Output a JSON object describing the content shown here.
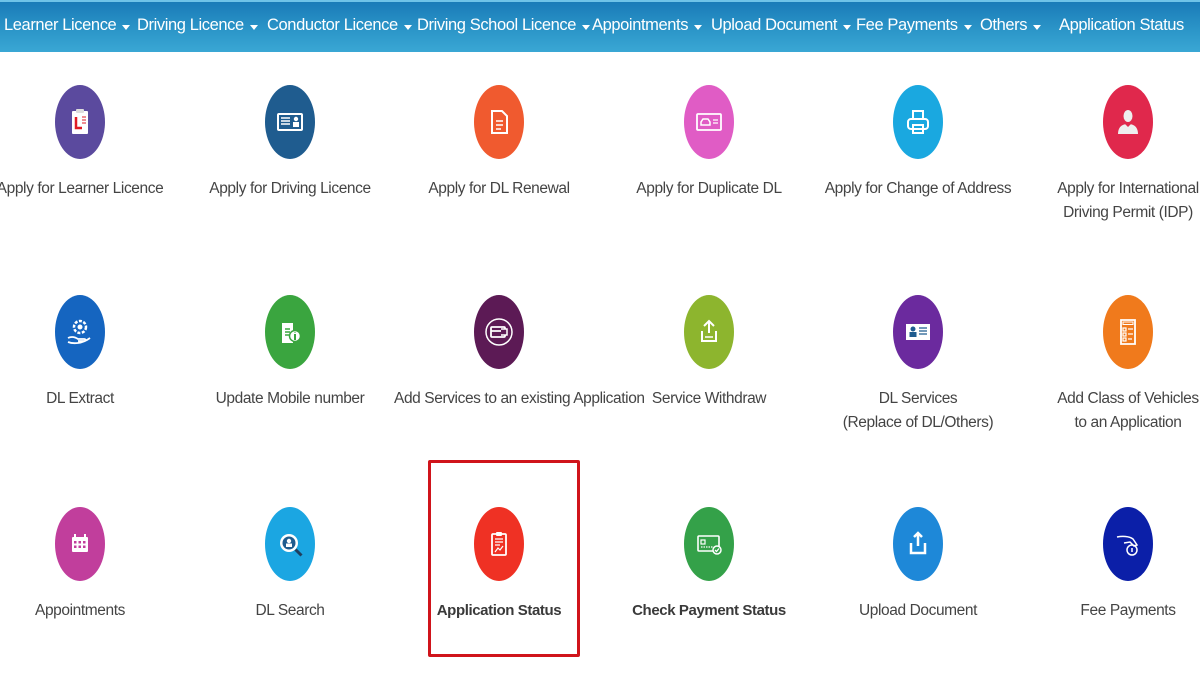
{
  "navbar": {
    "items": [
      {
        "label": "Learner Licence",
        "dropdown": true
      },
      {
        "label": "Driving Licence",
        "dropdown": true
      },
      {
        "label": "Conductor Licence",
        "dropdown": true
      },
      {
        "label": "Driving School Licence",
        "dropdown": true
      },
      {
        "label": "Appointments",
        "dropdown": true
      },
      {
        "label": "Upload Document",
        "dropdown": true
      },
      {
        "label": "Fee Payments",
        "dropdown": true
      },
      {
        "label": "Others",
        "dropdown": true
      },
      {
        "label": "Application Status",
        "dropdown": false
      }
    ]
  },
  "services": [
    {
      "line1": "Apply for Learner Licence",
      "line2": "",
      "icon": "learner-clipboard-icon",
      "color": "#5b4a9e"
    },
    {
      "line1": "Apply for Driving Licence",
      "line2": "",
      "icon": "id-card-icon",
      "color": "#1f5c8f"
    },
    {
      "line1": "Apply for DL Renewal",
      "line2": "",
      "icon": "document-icon",
      "color": "#f05a2f"
    },
    {
      "line1": "Apply for Duplicate DL",
      "line2": "",
      "icon": "car-card-icon",
      "color": "#e05cc5"
    },
    {
      "line1": "Apply for Change of Address",
      "line2": "",
      "icon": "printer-icon",
      "color": "#1aa8e0"
    },
    {
      "line1": "Apply for International",
      "line2": "Driving Permit (IDP)",
      "icon": "person-icon",
      "color": "#e0284c"
    },
    {
      "line1": "DL Extract",
      "line2": "",
      "icon": "gear-hand-icon",
      "color": "#1565c0"
    },
    {
      "line1": "Update Mobile number",
      "line2": "",
      "icon": "document-info-icon",
      "color": "#3aa53f"
    },
    {
      "line1": "Add Services to an existing Application",
      "line2": "",
      "icon": "card-plug-icon",
      "color": "#5c1a55"
    },
    {
      "line1": "Service Withdraw",
      "line2": "",
      "icon": "upload-tray-icon",
      "color": "#8db52e"
    },
    {
      "line1": "DL Services",
      "line2": "(Replace of DL/Others)",
      "icon": "profile-card-icon",
      "color": "#6b2a9e"
    },
    {
      "line1": "Add Class of Vehicles",
      "line2": "to an Application",
      "icon": "checklist-icon",
      "color": "#f07a1c"
    },
    {
      "line1": "Appointments",
      "line2": "",
      "icon": "calendar-icon",
      "color": "#c13e9c"
    },
    {
      "line1": "DL Search",
      "line2": "",
      "icon": "search-person-icon",
      "color": "#1ba6e2"
    },
    {
      "line1": "Application Status",
      "line2": "",
      "icon": "clipboard-chart-icon",
      "color": "#ef3124",
      "highlighted": true
    },
    {
      "line1": "Check Payment Status",
      "line2": "",
      "icon": "card-check-icon",
      "color": "#34a149"
    },
    {
      "line1": "Upload Document",
      "line2": "",
      "icon": "upload-icon",
      "color": "#1e88d8"
    },
    {
      "line1": "Fee Payments",
      "line2": "",
      "icon": "hand-coin-icon",
      "color": "#0b1fa8"
    }
  ]
}
